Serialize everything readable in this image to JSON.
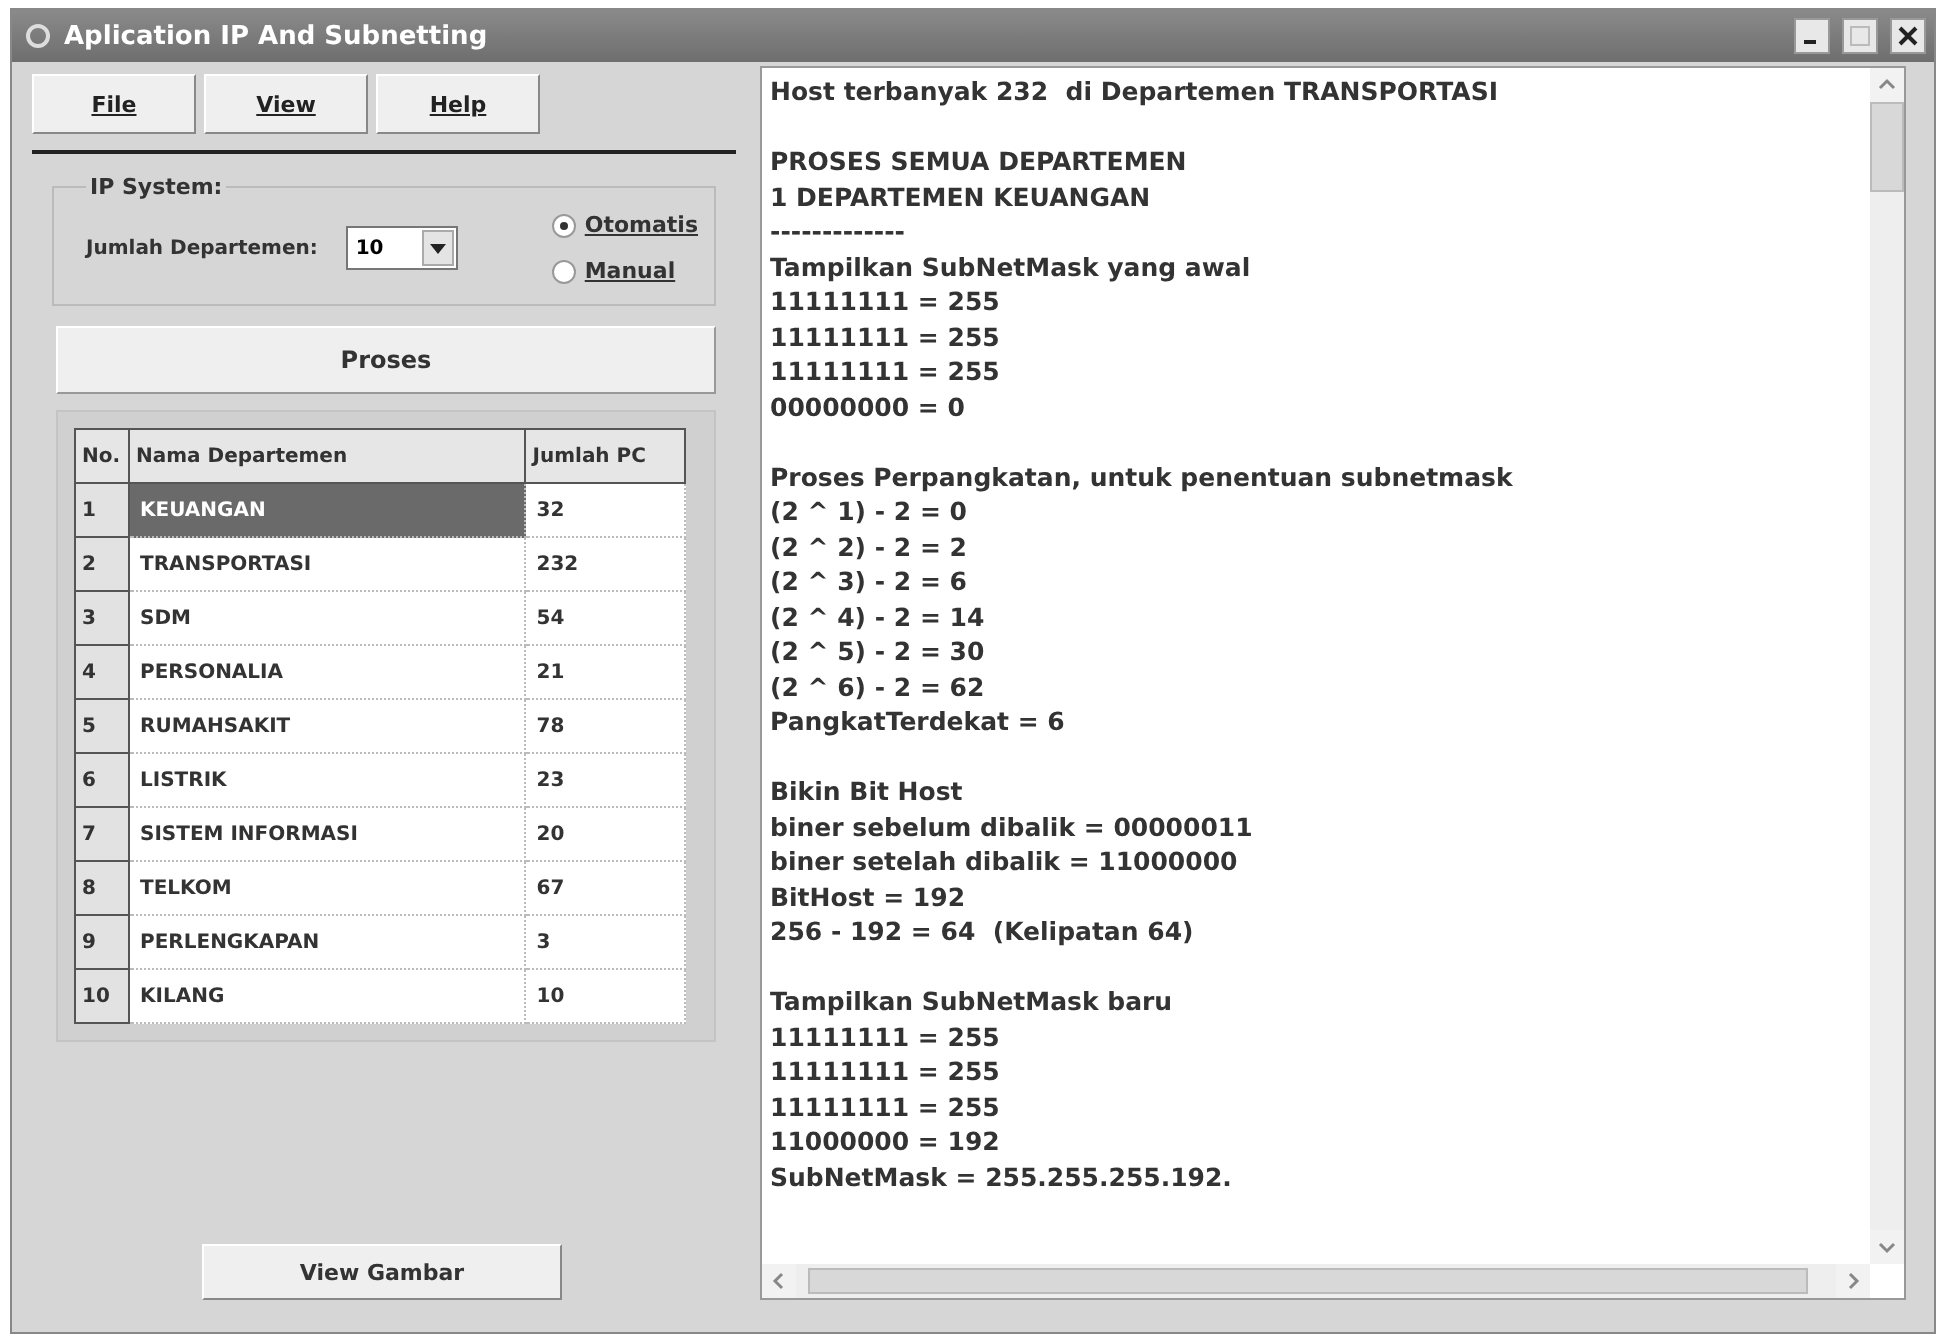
{
  "window": {
    "title": "Aplication IP And Subnetting"
  },
  "menu": [
    {
      "label": "File"
    },
    {
      "label": "View"
    },
    {
      "label": "Help"
    }
  ],
  "ip_system": {
    "title": "IP System:",
    "count_label": "Jumlah Departemen:",
    "count_value": "10",
    "modes": [
      {
        "label": "Otomatis",
        "selected": true
      },
      {
        "label": "Manual",
        "selected": false
      }
    ]
  },
  "process_button": "Proses",
  "table": {
    "columns": [
      "No.",
      "Nama Departemen",
      "Jumlah PC"
    ],
    "rows": [
      {
        "no": "1",
        "name": "KEUANGAN",
        "pc": "32",
        "selected": true
      },
      {
        "no": "2",
        "name": "TRANSPORTASI",
        "pc": "232",
        "selected": false
      },
      {
        "no": "3",
        "name": "SDM",
        "pc": "54",
        "selected": false
      },
      {
        "no": "4",
        "name": "PERSONALIA",
        "pc": "21",
        "selected": false
      },
      {
        "no": "5",
        "name": "RUMAHSAKIT",
        "pc": "78",
        "selected": false
      },
      {
        "no": "6",
        "name": "LISTRIK",
        "pc": "23",
        "selected": false
      },
      {
        "no": "7",
        "name": "SISTEM INFORMASI",
        "pc": "20",
        "selected": false
      },
      {
        "no": "8",
        "name": "TELKOM",
        "pc": "67",
        "selected": false
      },
      {
        "no": "9",
        "name": "PERLENGKAPAN",
        "pc": "3",
        "selected": false
      },
      {
        "no": "10",
        "name": "KILANG",
        "pc": "10",
        "selected": false
      }
    ]
  },
  "view_button": "View Gambar",
  "output": {
    "blocks": [
      [
        "Host terbanyak 232  di Departemen TRANSPORTASI"
      ],
      [
        "PROSES SEMUA DEPARTEMEN",
        "1 DEPARTEMEN KEUANGAN",
        "-------------",
        "Tampilkan SubNetMask yang awal",
        "11111111 = 255",
        "11111111 = 255",
        "11111111 = 255",
        "00000000 = 0"
      ],
      [
        "Proses Perpangkatan, untuk penentuan subnetmask",
        "(2 ^ 1) - 2 = 0",
        "(2 ^ 2) - 2 = 2",
        "(2 ^ 3) - 2 = 6",
        "(2 ^ 4) - 2 = 14",
        "(2 ^ 5) - 2 = 30",
        "(2 ^ 6) - 2 = 62",
        "PangkatTerdekat = 6"
      ],
      [
        "Bikin Bit Host",
        "biner sebelum dibalik = 00000011",
        "biner setelah dibalik = 11000000",
        "BitHost = 192",
        "256 - 192 = 64  (Kelipatan 64)"
      ],
      [
        "Tampilkan SubNetMask baru",
        "11111111 = 255",
        "11111111 = 255",
        "11111111 = 255",
        "11000000 = 192",
        "SubNetMask = 255.255.255.192."
      ]
    ]
  }
}
